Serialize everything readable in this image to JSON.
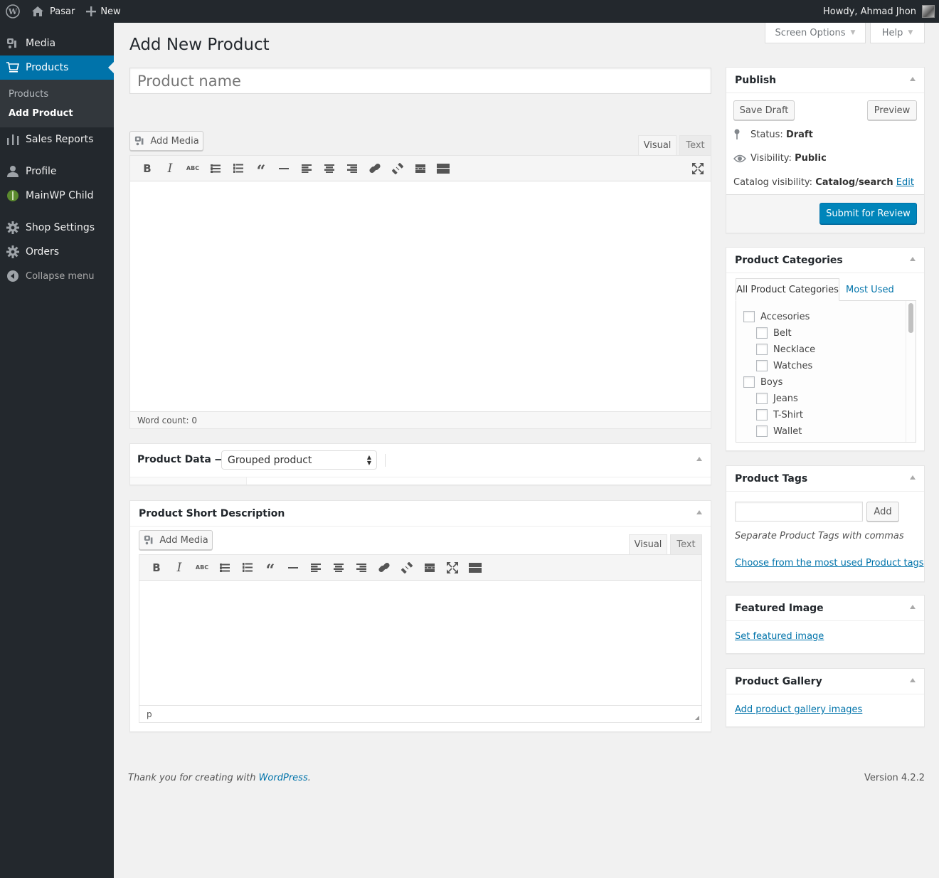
{
  "admin_bar": {
    "site_name": "Pasar",
    "new_label": "New",
    "greeting": "Howdy, Ahmad Jhon",
    "icons": {
      "logo": "wordpress-logo-icon",
      "home": "home-icon",
      "new": "plus-icon",
      "avatar": "user-avatar"
    }
  },
  "sidebar": {
    "items": [
      {
        "label": "Media",
        "icon": "media-icon"
      },
      {
        "label": "Products",
        "icon": "cart-icon",
        "current": true
      },
      {
        "label": "Sales Reports",
        "icon": "bar-chart-icon"
      },
      {
        "label": "Profile",
        "icon": "user-icon"
      },
      {
        "label": "MainWP Child",
        "icon": "mainwp-icon"
      },
      {
        "label": "Shop Settings",
        "icon": "gear-icon"
      },
      {
        "label": "Orders",
        "icon": "gear-icon"
      }
    ],
    "submenu": [
      "Products",
      "Add Product"
    ],
    "collapse_label": "Collapse menu"
  },
  "screen_options": {
    "label": "Screen Options",
    "help": "Help"
  },
  "page": {
    "title": "Add New Product",
    "product_name_placeholder": "Product name"
  },
  "editor": {
    "add_media": "Add Media",
    "tab_visual": "Visual",
    "tab_text": "Text",
    "word_count": "Word count: 0",
    "toolbar": [
      "bold",
      "italic",
      "strikethrough",
      "bulleted-list",
      "numbered-list",
      "blockquote",
      "horizontal-line",
      "align-left",
      "align-center",
      "align-right",
      "insert-link",
      "remove-link",
      "read-more",
      "toolbar-toggle"
    ]
  },
  "product_data": {
    "label": "Product Data —",
    "type_selected": "Grouped product"
  },
  "short_description": {
    "title": "Product Short Description",
    "add_media": "Add Media",
    "tab_visual": "Visual",
    "tab_text": "Text",
    "path": "p"
  },
  "publish": {
    "title": "Publish",
    "save_draft": "Save Draft",
    "preview": "Preview",
    "status_label": "Status:",
    "status_value": "Draft",
    "visibility_label": "Visibility:",
    "visibility_value": "Public",
    "catalog_label": "Catalog visibility:",
    "catalog_value": "Catalog/search",
    "edit": "Edit",
    "submit": "Submit for Review"
  },
  "categories": {
    "title": "Product Categories",
    "tab_all": "All Product Categories",
    "tab_most_used": "Most Used",
    "items": [
      {
        "label": "Accesories",
        "level": 0,
        "checked": false
      },
      {
        "label": "Belt",
        "level": 1,
        "checked": false
      },
      {
        "label": "Necklace",
        "level": 1,
        "checked": false
      },
      {
        "label": "Watches",
        "level": 1,
        "checked": false
      },
      {
        "label": "Boys",
        "level": 0,
        "checked": false
      },
      {
        "label": "Jeans",
        "level": 1,
        "checked": false
      },
      {
        "label": "T-Shirt",
        "level": 1,
        "checked": false
      },
      {
        "label": "Wallet",
        "level": 1,
        "checked": false
      }
    ]
  },
  "tags": {
    "title": "Product Tags",
    "input_value": "",
    "add": "Add",
    "hint": "Separate Product Tags with commas",
    "choose_link": "Choose from the most used Product tags"
  },
  "featured_image": {
    "title": "Featured Image",
    "link": "Set featured image"
  },
  "gallery": {
    "title": "Product Gallery",
    "link": "Add product gallery images"
  },
  "footer": {
    "thanks": "Thank you for creating with ",
    "wp_link": "WordPress",
    "period": ".",
    "version": "Version 4.2.2"
  },
  "colors": {
    "accent": "#0073aa",
    "primary_button": "#0085ba",
    "sidebar_bg": "#23282d",
    "submenu_bg": "#32373c"
  }
}
